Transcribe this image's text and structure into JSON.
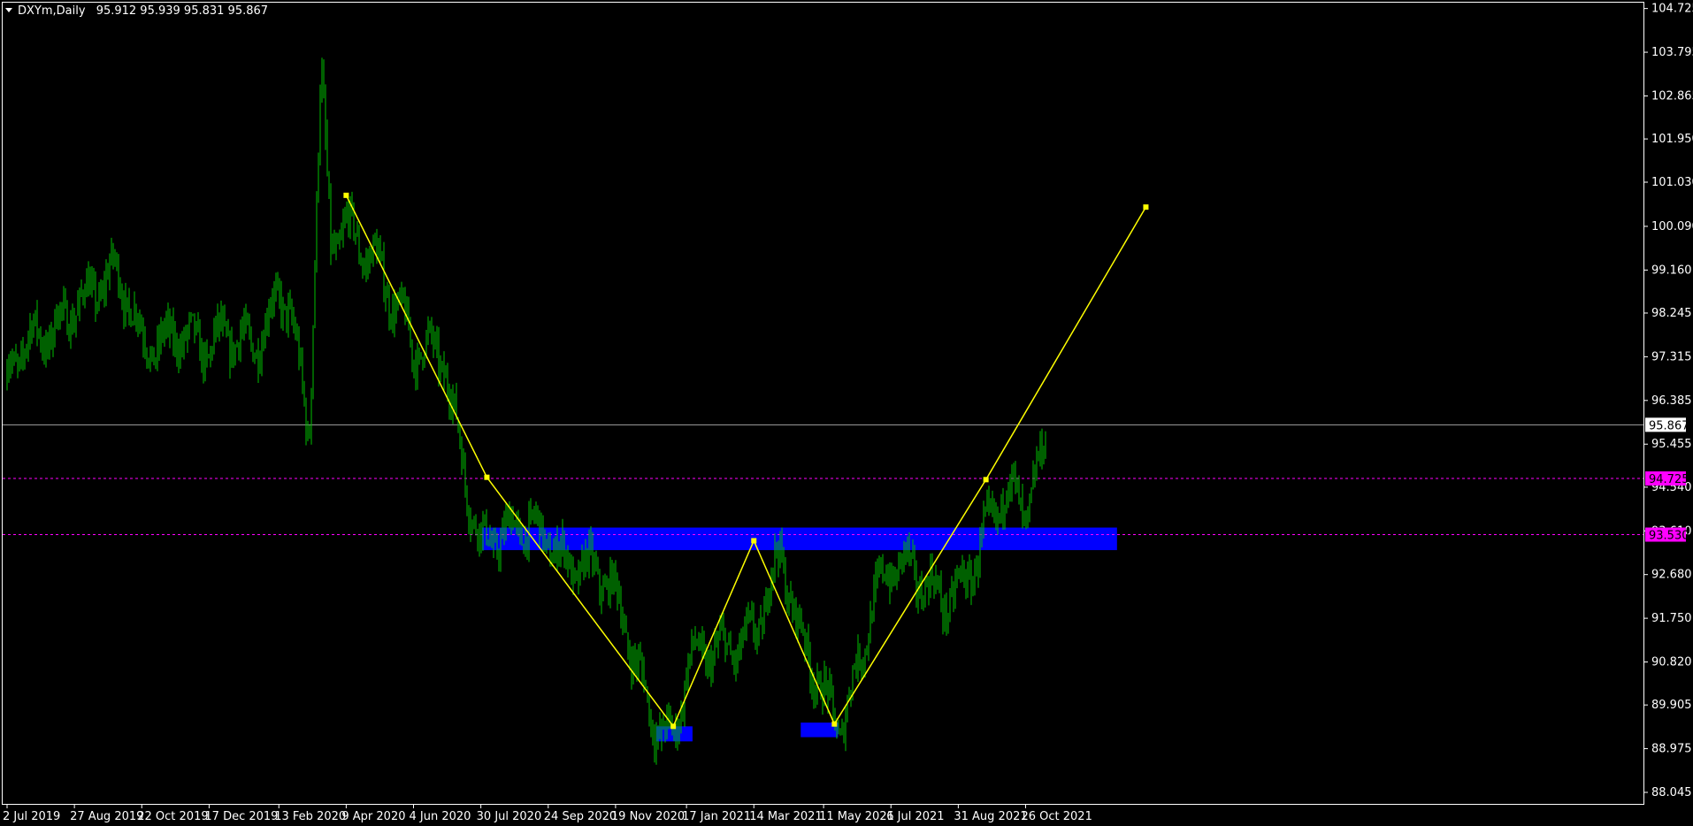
{
  "header": {
    "symbol": "DXYm,Daily",
    "ohlc": "95.912 95.939 95.831 95.867"
  },
  "colors": {
    "background": "#000000",
    "candles": "#00c000",
    "axis": "#ffffff",
    "pattern_line": "#ffff00",
    "zone": "#0000ff",
    "level_line": "#ff00ff",
    "price_line": "#a0a0a0"
  },
  "chart_data": {
    "type": "line",
    "title": "DXYm,Daily",
    "ylim": [
      87.8,
      104.85
    ],
    "y_ticks": [
      "104.725",
      "103.795",
      "102.865",
      "101.950",
      "101.030",
      "100.090",
      "99.160",
      "98.245",
      "97.315",
      "96.385",
      "95.455",
      "94.540",
      "93.610",
      "92.680",
      "91.750",
      "90.820",
      "89.905",
      "88.975",
      "88.045"
    ],
    "x_ticks": [
      "2 Jul 2019",
      "27 Aug 2019",
      "22 Oct 2019",
      "17 Dec 2019",
      "13 Feb 2020",
      "9 Apr 2020",
      "4 Jun 2020",
      "30 Jul 2020",
      "24 Sep 2020",
      "19 Nov 2020",
      "17 Jan 2021",
      "14 Mar 2021",
      "11 May 2021",
      "6 Jul 2021",
      "31 Aug 2021",
      "26 Oct 2021"
    ],
    "series": [
      {
        "x": [
          "2019-07-02",
          "2019-08-01",
          "2019-08-27",
          "2019-09-30",
          "2019-10-22",
          "2019-11-20",
          "2019-12-17",
          "2020-01-20",
          "2020-02-13",
          "2020-02-21",
          "2020-03-09",
          "2020-03-19",
          "2020-03-27",
          "2020-04-09",
          "2020-05-01",
          "2020-06-04",
          "2020-06-30",
          "2020-07-30",
          "2020-08-20",
          "2020-09-24",
          "2020-10-20",
          "2020-11-19",
          "2020-12-17",
          "2021-01-06",
          "2021-01-17",
          "2021-02-10",
          "2021-03-14",
          "2021-04-05",
          "2021-04-20",
          "2021-05-11",
          "2021-05-25",
          "2021-06-20",
          "2021-07-06",
          "2021-07-30",
          "2021-08-31",
          "2021-09-22",
          "2021-10-10",
          "2021-10-26",
          "2021-11-12"
        ],
        "values": [
          96.7,
          97.6,
          98.9,
          98.7,
          97.5,
          98.3,
          97.1,
          97.7,
          99.0,
          98.6,
          95.2,
          102.9,
          99.4,
          100.3,
          99.9,
          97.0,
          97.4,
          93.5,
          93.1,
          93.8,
          93.0,
          91.8,
          90.2,
          89.4,
          90.6,
          90.6,
          91.9,
          93.2,
          91.0,
          89.9,
          89.8,
          92.2,
          92.5,
          92.4,
          92.7,
          93.2,
          94.1,
          94.1,
          95.9
        ]
      }
    ],
    "pattern": {
      "color": "#ffff00",
      "points": [
        {
          "x": "2020-04-09",
          "y": 100.75
        },
        {
          "x": "2020-08-04",
          "y": 94.75
        },
        {
          "x": "2021-01-06",
          "y": 89.45
        },
        {
          "x": "2021-03-14",
          "y": 93.4
        },
        {
          "x": "2021-05-20",
          "y": 89.5
        },
        {
          "x": "2021-09-23",
          "y": 94.7
        },
        {
          "x": "2022-02-03",
          "y": 100.5
        }
      ]
    },
    "zones": [
      {
        "x_start": "2020-07-31",
        "x_end": "2022-01-10",
        "y_low": 93.2,
        "y_high": 93.68
      },
      {
        "x_start": "2020-12-23",
        "x_end": "2021-01-22",
        "y_low": 89.13,
        "y_high": 89.45
      },
      {
        "x_start": "2021-04-22",
        "x_end": "2021-05-23",
        "y_low": 89.22,
        "y_high": 89.53
      }
    ],
    "levels": [
      {
        "label": "94.725",
        "value": 94.725,
        "color": "#ff00ff",
        "style": "dashed"
      },
      {
        "label": "93.530",
        "value": 93.53,
        "color": "#ff00ff",
        "style": "dashed"
      }
    ],
    "current_price": {
      "label": "95.867",
      "value": 95.867
    }
  }
}
